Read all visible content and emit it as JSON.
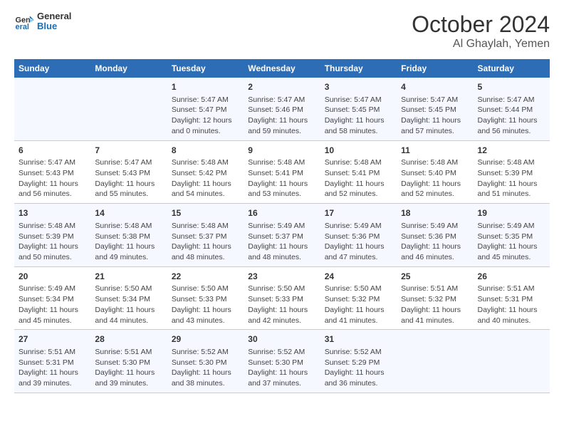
{
  "logo": {
    "line1": "General",
    "line2": "Blue"
  },
  "title": "October 2024",
  "subtitle": "Al Ghaylah, Yemen",
  "header_days": [
    "Sunday",
    "Monday",
    "Tuesday",
    "Wednesday",
    "Thursday",
    "Friday",
    "Saturday"
  ],
  "weeks": [
    [
      {
        "day": "",
        "info": ""
      },
      {
        "day": "",
        "info": ""
      },
      {
        "day": "1",
        "info": "Sunrise: 5:47 AM\nSunset: 5:47 PM\nDaylight: 12 hours and 0 minutes."
      },
      {
        "day": "2",
        "info": "Sunrise: 5:47 AM\nSunset: 5:46 PM\nDaylight: 11 hours and 59 minutes."
      },
      {
        "day": "3",
        "info": "Sunrise: 5:47 AM\nSunset: 5:45 PM\nDaylight: 11 hours and 58 minutes."
      },
      {
        "day": "4",
        "info": "Sunrise: 5:47 AM\nSunset: 5:45 PM\nDaylight: 11 hours and 57 minutes."
      },
      {
        "day": "5",
        "info": "Sunrise: 5:47 AM\nSunset: 5:44 PM\nDaylight: 11 hours and 56 minutes."
      }
    ],
    [
      {
        "day": "6",
        "info": "Sunrise: 5:47 AM\nSunset: 5:43 PM\nDaylight: 11 hours and 56 minutes."
      },
      {
        "day": "7",
        "info": "Sunrise: 5:47 AM\nSunset: 5:43 PM\nDaylight: 11 hours and 55 minutes."
      },
      {
        "day": "8",
        "info": "Sunrise: 5:48 AM\nSunset: 5:42 PM\nDaylight: 11 hours and 54 minutes."
      },
      {
        "day": "9",
        "info": "Sunrise: 5:48 AM\nSunset: 5:41 PM\nDaylight: 11 hours and 53 minutes."
      },
      {
        "day": "10",
        "info": "Sunrise: 5:48 AM\nSunset: 5:41 PM\nDaylight: 11 hours and 52 minutes."
      },
      {
        "day": "11",
        "info": "Sunrise: 5:48 AM\nSunset: 5:40 PM\nDaylight: 11 hours and 52 minutes."
      },
      {
        "day": "12",
        "info": "Sunrise: 5:48 AM\nSunset: 5:39 PM\nDaylight: 11 hours and 51 minutes."
      }
    ],
    [
      {
        "day": "13",
        "info": "Sunrise: 5:48 AM\nSunset: 5:39 PM\nDaylight: 11 hours and 50 minutes."
      },
      {
        "day": "14",
        "info": "Sunrise: 5:48 AM\nSunset: 5:38 PM\nDaylight: 11 hours and 49 minutes."
      },
      {
        "day": "15",
        "info": "Sunrise: 5:48 AM\nSunset: 5:37 PM\nDaylight: 11 hours and 48 minutes."
      },
      {
        "day": "16",
        "info": "Sunrise: 5:49 AM\nSunset: 5:37 PM\nDaylight: 11 hours and 48 minutes."
      },
      {
        "day": "17",
        "info": "Sunrise: 5:49 AM\nSunset: 5:36 PM\nDaylight: 11 hours and 47 minutes."
      },
      {
        "day": "18",
        "info": "Sunrise: 5:49 AM\nSunset: 5:36 PM\nDaylight: 11 hours and 46 minutes."
      },
      {
        "day": "19",
        "info": "Sunrise: 5:49 AM\nSunset: 5:35 PM\nDaylight: 11 hours and 45 minutes."
      }
    ],
    [
      {
        "day": "20",
        "info": "Sunrise: 5:49 AM\nSunset: 5:34 PM\nDaylight: 11 hours and 45 minutes."
      },
      {
        "day": "21",
        "info": "Sunrise: 5:50 AM\nSunset: 5:34 PM\nDaylight: 11 hours and 44 minutes."
      },
      {
        "day": "22",
        "info": "Sunrise: 5:50 AM\nSunset: 5:33 PM\nDaylight: 11 hours and 43 minutes."
      },
      {
        "day": "23",
        "info": "Sunrise: 5:50 AM\nSunset: 5:33 PM\nDaylight: 11 hours and 42 minutes."
      },
      {
        "day": "24",
        "info": "Sunrise: 5:50 AM\nSunset: 5:32 PM\nDaylight: 11 hours and 41 minutes."
      },
      {
        "day": "25",
        "info": "Sunrise: 5:51 AM\nSunset: 5:32 PM\nDaylight: 11 hours and 41 minutes."
      },
      {
        "day": "26",
        "info": "Sunrise: 5:51 AM\nSunset: 5:31 PM\nDaylight: 11 hours and 40 minutes."
      }
    ],
    [
      {
        "day": "27",
        "info": "Sunrise: 5:51 AM\nSunset: 5:31 PM\nDaylight: 11 hours and 39 minutes."
      },
      {
        "day": "28",
        "info": "Sunrise: 5:51 AM\nSunset: 5:30 PM\nDaylight: 11 hours and 39 minutes."
      },
      {
        "day": "29",
        "info": "Sunrise: 5:52 AM\nSunset: 5:30 PM\nDaylight: 11 hours and 38 minutes."
      },
      {
        "day": "30",
        "info": "Sunrise: 5:52 AM\nSunset: 5:30 PM\nDaylight: 11 hours and 37 minutes."
      },
      {
        "day": "31",
        "info": "Sunrise: 5:52 AM\nSunset: 5:29 PM\nDaylight: 11 hours and 36 minutes."
      },
      {
        "day": "",
        "info": ""
      },
      {
        "day": "",
        "info": ""
      }
    ]
  ]
}
